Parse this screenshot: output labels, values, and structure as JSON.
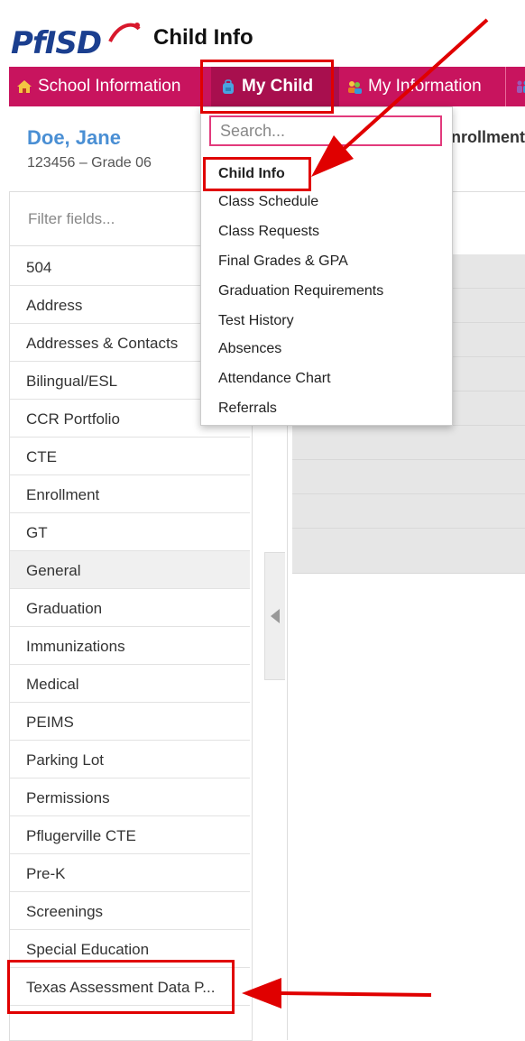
{
  "app": {
    "title": "Child Info",
    "logo_text": "PfISD"
  },
  "nav": {
    "items": [
      {
        "label": "School Information",
        "icon": "school-house-icon"
      },
      {
        "label": "My Child",
        "icon": "backpack-icon"
      },
      {
        "label": "My Information",
        "icon": "people-icon"
      },
      {
        "label": "",
        "icon": "family-icon"
      }
    ]
  },
  "student": {
    "name": "Doe, Jane",
    "details": "123456 – Grade 06"
  },
  "tabs": {
    "partial": "nrollment"
  },
  "sidebar": {
    "filter_placeholder": "Filter fields...",
    "items": [
      "504",
      "Address",
      "Addresses & Contacts",
      "Bilingual/ESL",
      "CCR Portfolio",
      "CTE",
      "Enrollment",
      "GT",
      "General",
      "Graduation",
      "Immunizations",
      "Medical",
      "PEIMS",
      "Parking Lot",
      "Permissions",
      "Pflugerville CTE",
      "Pre-K",
      "Screenings",
      "Special Education",
      "Texas Assessment Data P..."
    ],
    "active_index": 8
  },
  "dropdown": {
    "search_placeholder": "Search...",
    "items": [
      "Child Info",
      "Class Schedule",
      "Class Requests",
      "Final Grades & GPA",
      "Graduation Requirements",
      "Test History",
      "Absences",
      "Attendance Chart",
      "Referrals"
    ]
  },
  "colors": {
    "nav_bg": "#c8145e",
    "nav_active": "#a80f4e",
    "student_name": "#4a8fd4",
    "highlight": "#e00000",
    "logo": "#1b3f8f"
  }
}
